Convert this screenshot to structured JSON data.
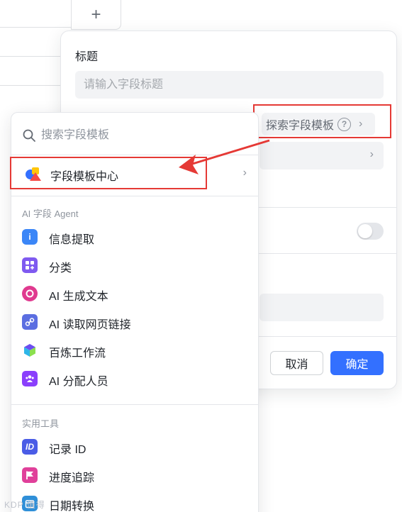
{
  "background": {
    "add_column_label": "+"
  },
  "dialog": {
    "title_label": "标题",
    "title_placeholder": "请输入字段标题",
    "explore_label": "探索字段模板",
    "help_glyph": "?",
    "chevron": "›",
    "cancel_label": "取消",
    "confirm_label": "确定",
    "toggle_on": false
  },
  "panel": {
    "search_placeholder": "搜索字段模板",
    "template_center_label": "字段模板中心",
    "chevron": "›",
    "ai_group": {
      "title": "AI 字段 Agent",
      "items": [
        {
          "label": "信息提取",
          "icon": "info-extract-icon",
          "color": "#3b86f7"
        },
        {
          "label": "分类",
          "icon": "classify-icon",
          "color": "#7f5af0"
        },
        {
          "label": "AI 生成文本",
          "icon": "ai-generate-icon",
          "color": "#e03a8f"
        },
        {
          "label": "AI 读取网页链接",
          "icon": "link-icon",
          "color": "#5b6ee1"
        },
        {
          "label": "百炼工作流",
          "icon": "bailian-icon",
          "color": "#6c4df0"
        },
        {
          "label": "AI 分配人员",
          "icon": "assign-people-icon",
          "color": "#8a3ffc"
        }
      ]
    },
    "tools_group": {
      "title": "实用工具",
      "items": [
        {
          "label": "记录 ID",
          "icon": "record-id-icon",
          "color": "#4a5ce6",
          "glyph": "ID"
        },
        {
          "label": "进度追踪",
          "icon": "flag-icon",
          "color": "#e0409a"
        },
        {
          "label": "日期转换",
          "icon": "date-convert-icon",
          "color": "#2f8fd8"
        }
      ]
    }
  },
  "watermark": "KDP 值得"
}
